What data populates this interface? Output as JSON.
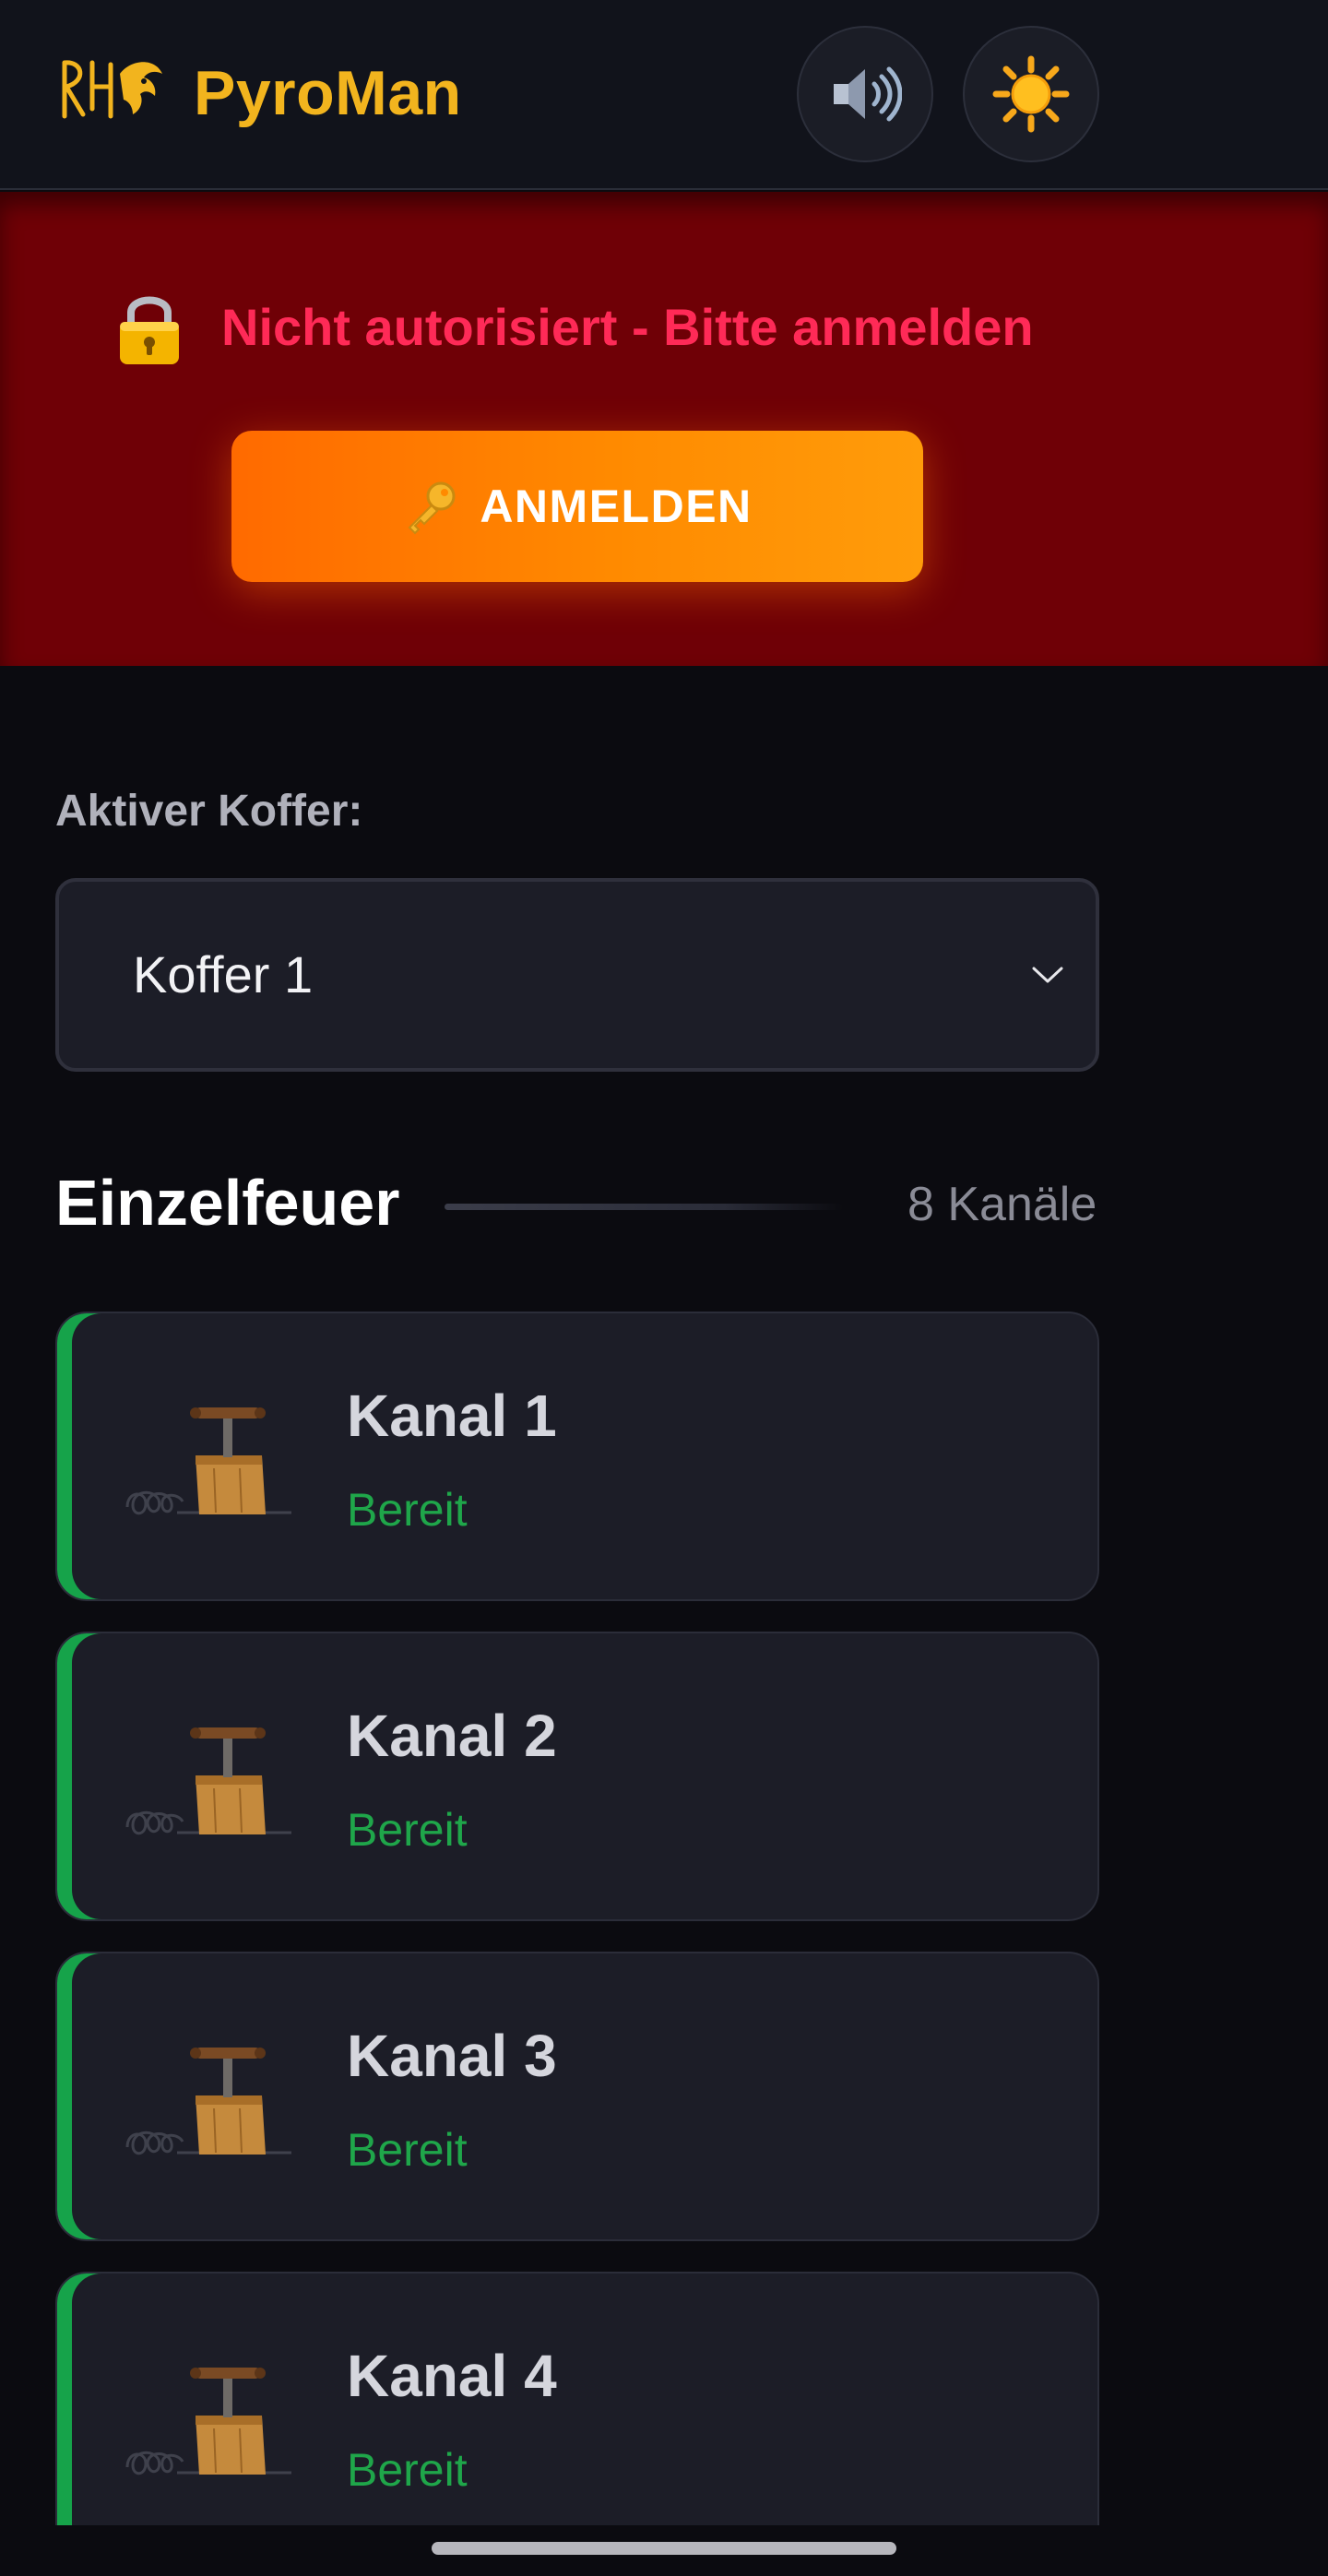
{
  "header": {
    "app_title": "PyroMan",
    "logo_icon": "pyroman-lion-logo",
    "sound_button_icon": "speaker-icon",
    "theme_button_icon": "sun-icon"
  },
  "auth_banner": {
    "message": "Nicht autorisiert - Bitte anmelden",
    "lock_icon": "lock-icon",
    "login_button_label": "ANMELDEN",
    "login_button_icon": "key-icon"
  },
  "koffer": {
    "label": "Aktiver Koffer:",
    "selected": "Koffer 1"
  },
  "section": {
    "title": "Einzelfeuer",
    "count": "8 Kanäle"
  },
  "channels": [
    {
      "title": "Kanal 1",
      "status": "Bereit"
    },
    {
      "title": "Kanal 2",
      "status": "Bereit"
    },
    {
      "title": "Kanal 3",
      "status": "Bereit"
    },
    {
      "title": "Kanal 4",
      "status": "Bereit"
    }
  ],
  "colors": {
    "accent": "#f2b41e",
    "banner_bg": "#6f0006",
    "error_text": "#ff2a57",
    "login_button": "#ff7a00",
    "ready_green": "#1fa64a",
    "card_bg": "#1c1d27"
  }
}
